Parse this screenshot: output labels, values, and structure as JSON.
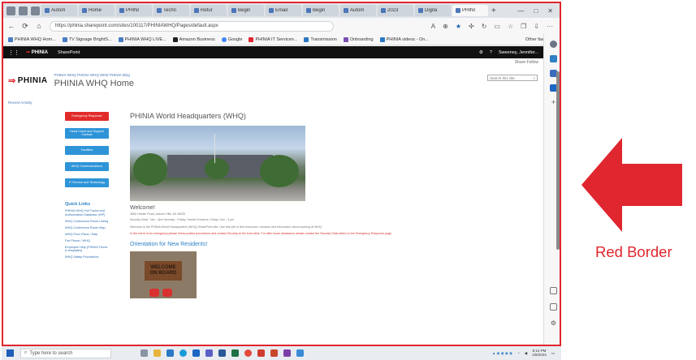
{
  "browser": {
    "tabs": [
      {
        "label": "Autom"
      },
      {
        "label": "Home"
      },
      {
        "label": "PHINI"
      },
      {
        "label": "Techn"
      },
      {
        "label": "Retur"
      },
      {
        "label": "Begin"
      },
      {
        "label": "Email"
      },
      {
        "label": "Begin"
      },
      {
        "label": "Autom"
      },
      {
        "label": "2023"
      },
      {
        "label": "Digita"
      },
      {
        "label": "PHINI"
      }
    ],
    "url": "https://phinia.sharepoint.com/sites/100117/PHINIAWHQ/Pages/default.aspx",
    "favorites": [
      {
        "label": "PHINIA WHQ Hom..."
      },
      {
        "label": "TV Signage BrightS..."
      },
      {
        "label": "PHINIA WHQ LIVE..."
      },
      {
        "label": "Amazon Business"
      },
      {
        "label": "Google"
      },
      {
        "label": "PHINIA IT Servicen..."
      },
      {
        "label": "Transmission"
      },
      {
        "label": "Onboarding"
      },
      {
        "label": "PHINIA videos - On..."
      }
    ],
    "other_favorites": "Other favorites"
  },
  "suitebar": {
    "brand": "PHINIA",
    "app": "SharePoint",
    "user": "Sweeney, Jennifer..."
  },
  "site": {
    "share_text": "Share  Follow",
    "crumbs": "PHINIA WHQ    PHINIA WHQ  NEW PHINIA Blog",
    "logo": "PHINIA",
    "title": "PHINIA WHQ Home",
    "search_placeholder": "Search this site",
    "recent": "Recent Activity"
  },
  "quicknav": [
    {
      "label": "Emergency Response",
      "color": "red"
    },
    {
      "label": "Head Count and Support Contact",
      "color": "blue"
    },
    {
      "label": "Facilities",
      "color": "blue"
    },
    {
      "label": "WHQ Communications",
      "color": "blue"
    },
    {
      "label": "IT Service and Technology",
      "color": "blue"
    }
  ],
  "quicklinks": {
    "title": "Quick Links",
    "items": [
      "PHINIA WHQ Hot Topics and Authorization Database (HIP)",
      "WHQ Conference Room Listing",
      "WHQ Conference Room Map",
      "WHQ Floor Plans / Map",
      "Fax Phone / WHQ",
      "Employee Help (PHINIA Forms & templates)",
      "WHQ Safety Procedures"
    ]
  },
  "main": {
    "title": "PHINIA World Headquarters (WHQ)",
    "welcome": "Welcome!",
    "address": "3850 Hamlin Road, Auburn Hills, MI 48326",
    "hours": "Security Desk: 7am - 5pm Monday - Friday; Hamlin Entrance, Friday 7am - 3 pm",
    "body": "Welcome to the PHINIA World Headquarters (WHQ) SharePoint site. Use this site to find resources, contacts and information about working at WHQ.",
    "red_notice": "In the event of an emergency please follow posted procedures and contact Security at the front desk. For after hours assistance please contact the Security Desk listed on the Emergency Response page.",
    "orientation": "Orientation for New Residents!",
    "mat_text": [
      "WELCOME",
      "ON BOARD"
    ]
  },
  "taskbar": {
    "search_placeholder": "Type here to search",
    "time": "5:14 PM",
    "date": "1/8/2024"
  },
  "annotation": {
    "label": "Red Border",
    "color": "#e0262e"
  }
}
